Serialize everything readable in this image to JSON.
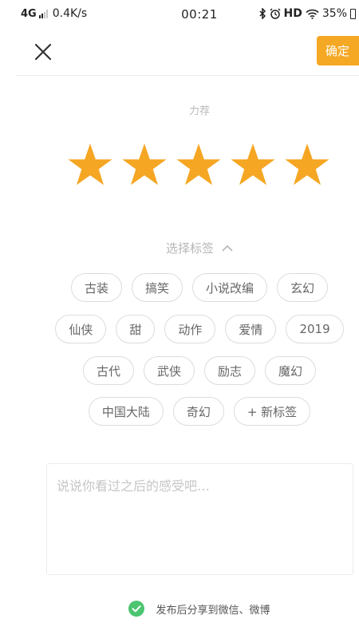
{
  "status_bar": {
    "network": "4G",
    "speed": "0.4K/s",
    "time": "00:21",
    "hd": "HD",
    "battery": "35%"
  },
  "top_bar": {
    "close_icon": "close-icon",
    "confirm_label": "确定"
  },
  "rating": {
    "label": "力荐",
    "stars_total": 5,
    "stars_filled": 5,
    "star_color": "#f5a623"
  },
  "tags": {
    "header_label": "选择标签",
    "rows": [
      [
        "古装",
        "搞笑",
        "小说改编",
        "玄幻"
      ],
      [
        "仙侠",
        "甜",
        "动作",
        "爱情",
        "2019"
      ],
      [
        "古代",
        "武侠",
        "励志",
        "魔幻"
      ],
      [
        "中国大陆",
        "奇幻",
        "+ 新标签"
      ]
    ]
  },
  "comment": {
    "placeholder": "说说你看过之后的感受吧…"
  },
  "share": {
    "label": "发布后分享到微信、微博",
    "checked": true,
    "check_color": "#4cc571"
  },
  "colors": {
    "accent": "#f5a823",
    "tag_border": "#dcdcdc",
    "muted_text": "#b6b6b6"
  }
}
